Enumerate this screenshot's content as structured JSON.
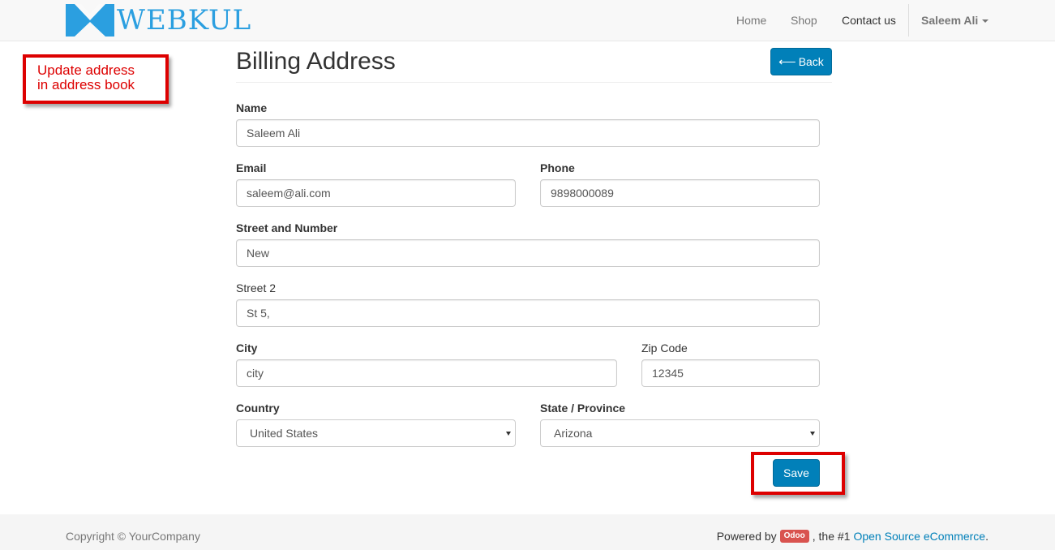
{
  "navbar": {
    "logo_text": "WEBKUL",
    "items": [
      {
        "label": "Home"
      },
      {
        "label": "Shop"
      },
      {
        "label": "Contact us"
      }
    ],
    "user": "Saleem Ali"
  },
  "annotation": {
    "text_line1": "Update address",
    "text_line2": "in address book"
  },
  "page": {
    "title": "Billing Address",
    "back_label": "Back"
  },
  "form": {
    "name_label": "Name",
    "name_value": "Saleem Ali",
    "email_label": "Email",
    "email_value": "saleem@ali.com",
    "phone_label": "Phone",
    "phone_value": "9898000089",
    "street_label": "Street and Number",
    "street_value": "New",
    "street2_label": "Street 2",
    "street2_value": "St 5,",
    "city_label": "City",
    "city_value": "city",
    "zip_label": "Zip Code",
    "zip_value": "12345",
    "country_label": "Country",
    "country_value": "United States",
    "state_label": "State / Province",
    "state_value": "Arizona",
    "save_label": "Save"
  },
  "footer": {
    "copyright": "Copyright © YourCompany",
    "powered_prefix": "Powered by",
    "odoo_badge": "Odoo",
    "powered_middle": ", the #1",
    "powered_link": "Open Source eCommerce",
    "powered_suffix": "."
  },
  "colors": {
    "brand_blue": "#2b9fe0",
    "button_blue": "#0180b9",
    "annotation_red": "#dd0000",
    "odoo_red": "#d9534f"
  }
}
